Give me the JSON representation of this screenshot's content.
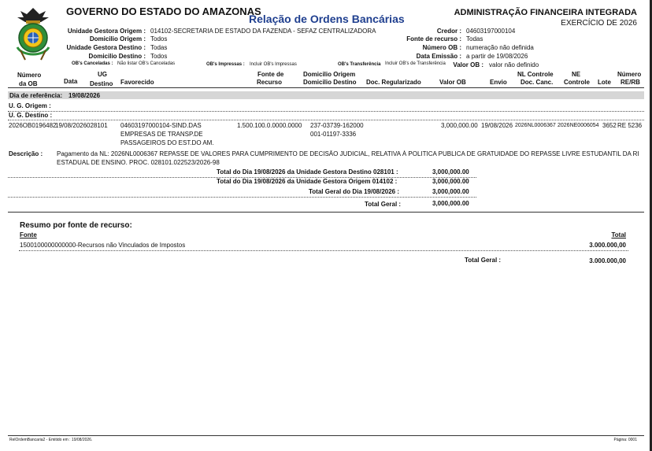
{
  "header": {
    "govt": "GOVERNO DO ESTADO DO AMAZONAS",
    "title": "Relação de Ordens Bancárias",
    "admin": "ADMINISTRAÇÃO FINANCEIRA INTEGRADA",
    "exercicio": "EXERCÍCIO DE 2026",
    "ug_origem_label": "Unidade Gestora Origem :",
    "ug_origem_value": "014102-SECRETARIA DE ESTADO DA FAZENDA - SEFAZ CENTRALIZADORA",
    "dom_origem_label": "Domicilio Origem :",
    "dom_origem_value": "Todos",
    "ug_destino_label": "Unidade Gestora Destino :",
    "ug_destino_value": "Todas",
    "dom_destino_label": "Domicilio Destino :",
    "dom_destino_value": "Todos",
    "credor_label": "Credor :",
    "credor_value": "04603197000104",
    "fonte_label": "Fonte de recurso :",
    "fonte_value": "Todas",
    "num_ob_label": "Número OB :",
    "num_ob_value": "numeração não definida",
    "data_emissao_label": "Data Emissão :",
    "data_emissao_value": "a partir de 19/08/2026",
    "valor_ob_label": "Valor OB :",
    "valor_ob_value": "valor não definido",
    "canceladas_label": "OB's Canceladas :",
    "canceladas_value": "Não listar OB's Canceladas",
    "impressas_label": "OB's Impressas :",
    "impressas_value": "Incluir OB's Impressas",
    "transferencia_label": "OB's Transferência",
    "transferencia_value": "Incluir OB's de Transferência"
  },
  "columns": {
    "numero_1": "Número",
    "numero_2": "da OB",
    "data": "Data",
    "ug_1": "UG",
    "ug_2": "Destino",
    "favorecido": "Favorecido",
    "fonte_1": "Fonte de",
    "fonte_2": "Recurso",
    "dom_1": "Domicilio Origem",
    "dom_2": "Domicilio Destino",
    "doc_reg": "Doc. Regularizado",
    "valor_ob": "Valor OB",
    "envio": "Envio",
    "nl_1": "NL Controle",
    "nl_2": "Doc. Canc.",
    "ne_1": "NE",
    "ne_2": "Controle",
    "lote": "Lote",
    "num_1": "Número",
    "num_2": "RE/RB"
  },
  "dia_ref": {
    "label": "Dia de referência:",
    "value": "19/08/2026"
  },
  "ug_origem_row": "U. G. Origem  :",
  "ug_destino_row": "U. G. Destino :",
  "record": {
    "numero": "2026OB0196482",
    "data": "19/08/2026",
    "ug": "028101",
    "favorecido_1": "04603197000104-SIND.DAS",
    "favorecido_2": "EMPRESAS DE TRANSP.DE",
    "favorecido_3": "PASSAGEIROS DO EST.DO AM.",
    "fonte": "1.500.100.0.0000.0000",
    "dom_1": "237-03739-162000",
    "dom_2": "001-01197-3336",
    "valor": "3,000,000.00",
    "envio": "19/08/2026",
    "nl": "2026NL0006367",
    "ne": "2026NE0006054",
    "lote": "3652",
    "re": "RE 5236"
  },
  "descricao": {
    "label": "Descrição :",
    "line1": "Pagamento da NL: 2026NL0006367 REPASSE DE VALORES PARA CUMPRIMENTO DE DECISÃO JUDICIAL, RELATIVA À POLITICA PUBLICA DE GRATUIDADE DO REPASSE LIVRE ESTUDANTIL DA RI",
    "line2": "ESTADUAL DE ENSINO. PROC. 028101.022523/2026-98"
  },
  "totals": {
    "dia_ug_destino_label": "Total do Dia 19/08/2026  da Unidade Gestora Destino  028101  :",
    "dia_ug_destino_value": "3,000,000.00",
    "dia_ug_origem_label": "Total do Dia 19/08/2026  da Unidade Gestora Origem  014102  :",
    "dia_ug_origem_value": "3,000,000.00",
    "geral_dia_label": "Total Geral do Dia 19/08/2026  :",
    "geral_dia_value": "3,000,000.00",
    "geral_label": "Total Geral :",
    "geral_value": "3,000,000.00"
  },
  "resumo": {
    "title": "Resumo por fonte de recurso:",
    "col_fonte": "Fonte",
    "col_total": "Total",
    "row_fonte": "1500100000000000-Recursos não Vinculados de Impostos",
    "row_total": "3.000.000,00",
    "geral_label": "Total Geral :",
    "geral_value": "3.000.000,00"
  },
  "footer": {
    "left": "RelOrdemBancaria2 - Emitido em : 19/08/2026.",
    "right": "Página: 0001"
  },
  "colors": {
    "title_blue": "#1f3f8f",
    "band_gray": "#d6d6d6"
  }
}
